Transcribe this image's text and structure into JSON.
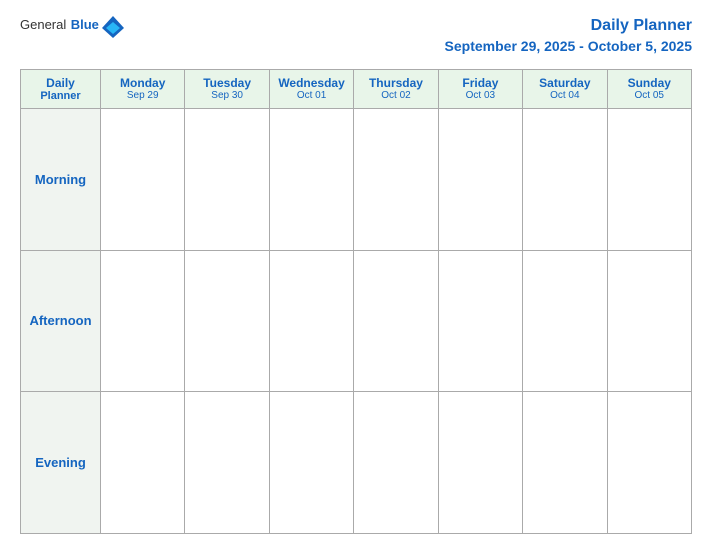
{
  "logo": {
    "general": "General",
    "blue": "Blue"
  },
  "title": {
    "line1": "Daily Planner",
    "line2": "September 29, 2025 - October 5, 2025"
  },
  "columns": [
    {
      "id": "label",
      "day": "Daily",
      "sub": "Planner",
      "is_label": true
    },
    {
      "id": "mon",
      "day": "Monday",
      "sub": "Sep 29"
    },
    {
      "id": "tue",
      "day": "Tuesday",
      "sub": "Sep 30"
    },
    {
      "id": "wed",
      "day": "Wednesday",
      "sub": "Oct 01"
    },
    {
      "id": "thu",
      "day": "Thursday",
      "sub": "Oct 02"
    },
    {
      "id": "fri",
      "day": "Friday",
      "sub": "Oct 03"
    },
    {
      "id": "sat",
      "day": "Saturday",
      "sub": "Oct 04"
    },
    {
      "id": "sun",
      "day": "Sunday",
      "sub": "Oct 05"
    }
  ],
  "rows": [
    {
      "id": "morning",
      "label": "Morning"
    },
    {
      "id": "afternoon",
      "label": "Afternoon"
    },
    {
      "id": "evening",
      "label": "Evening"
    }
  ]
}
